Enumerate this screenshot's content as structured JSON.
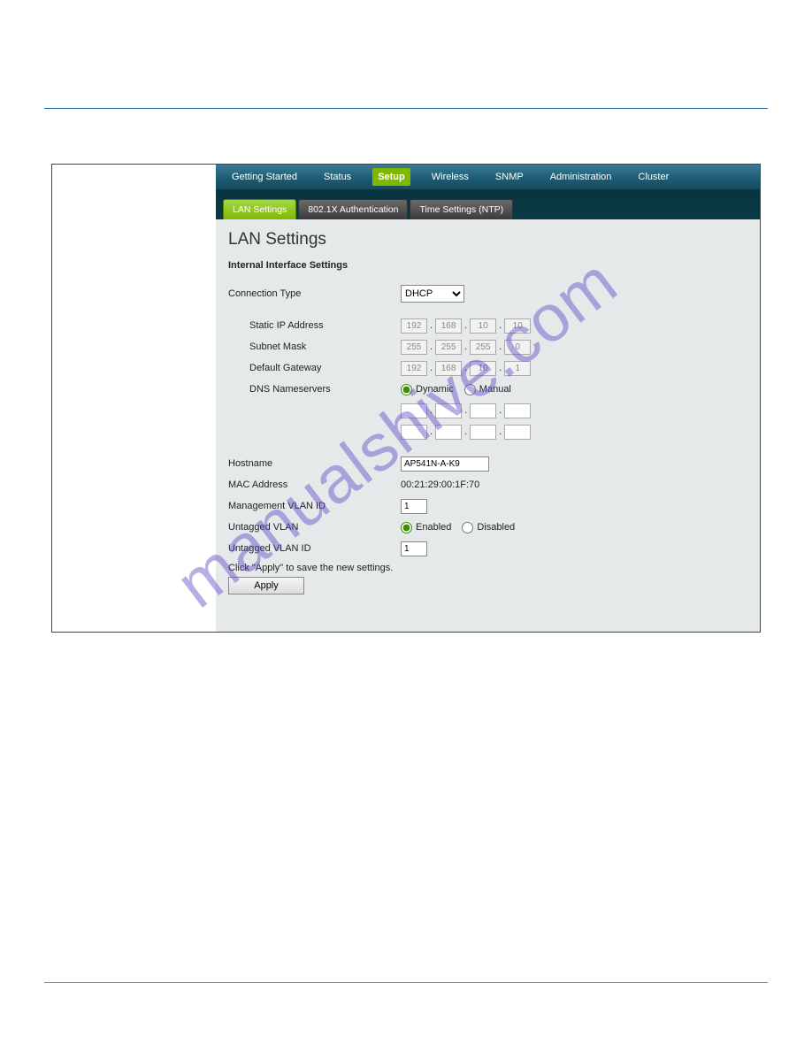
{
  "nav": {
    "items": [
      {
        "label": "Getting Started"
      },
      {
        "label": "Status"
      },
      {
        "label": "Setup"
      },
      {
        "label": "Wireless"
      },
      {
        "label": "SNMP"
      },
      {
        "label": "Administration"
      },
      {
        "label": "Cluster"
      }
    ]
  },
  "subnav": {
    "items": [
      {
        "label": "LAN Settings"
      },
      {
        "label": "802.1X Authentication"
      },
      {
        "label": "Time Settings (NTP)"
      }
    ]
  },
  "page": {
    "title": "LAN Settings",
    "section": "Internal Interface Settings"
  },
  "form": {
    "connection_type_label": "Connection Type",
    "connection_type_value": "DHCP",
    "static_ip_label": "Static IP Address",
    "static_ip": {
      "a": "192",
      "b": "168",
      "c": "10",
      "d": "10"
    },
    "subnet_label": "Subnet Mask",
    "subnet": {
      "a": "255",
      "b": "255",
      "c": "255",
      "d": "0"
    },
    "gateway_label": "Default Gateway",
    "gateway": {
      "a": "192",
      "b": "168",
      "c": "10",
      "d": "1"
    },
    "dns_label": "DNS Nameservers",
    "dns_dynamic": "Dynamic",
    "dns_manual": "Manual",
    "dns1": {
      "a": "",
      "b": "",
      "c": "",
      "d": ""
    },
    "dns2": {
      "a": "",
      "b": "",
      "c": "",
      "d": ""
    },
    "hostname_label": "Hostname",
    "hostname_value": "AP541N-A-K9",
    "mac_label": "MAC Address",
    "mac_value": "00:21:29:00:1F:70",
    "mgmt_vlan_label": "Management VLAN ID",
    "mgmt_vlan_value": "1",
    "untagged_vlan_label": "Untagged VLAN",
    "untagged_enabled": "Enabled",
    "untagged_disabled": "Disabled",
    "untagged_vlan_id_label": "Untagged VLAN ID",
    "untagged_vlan_id_value": "1",
    "apply_msg": "Click \"Apply\" to save the new settings.",
    "apply_btn": "Apply"
  },
  "watermark": "manualshive.com"
}
